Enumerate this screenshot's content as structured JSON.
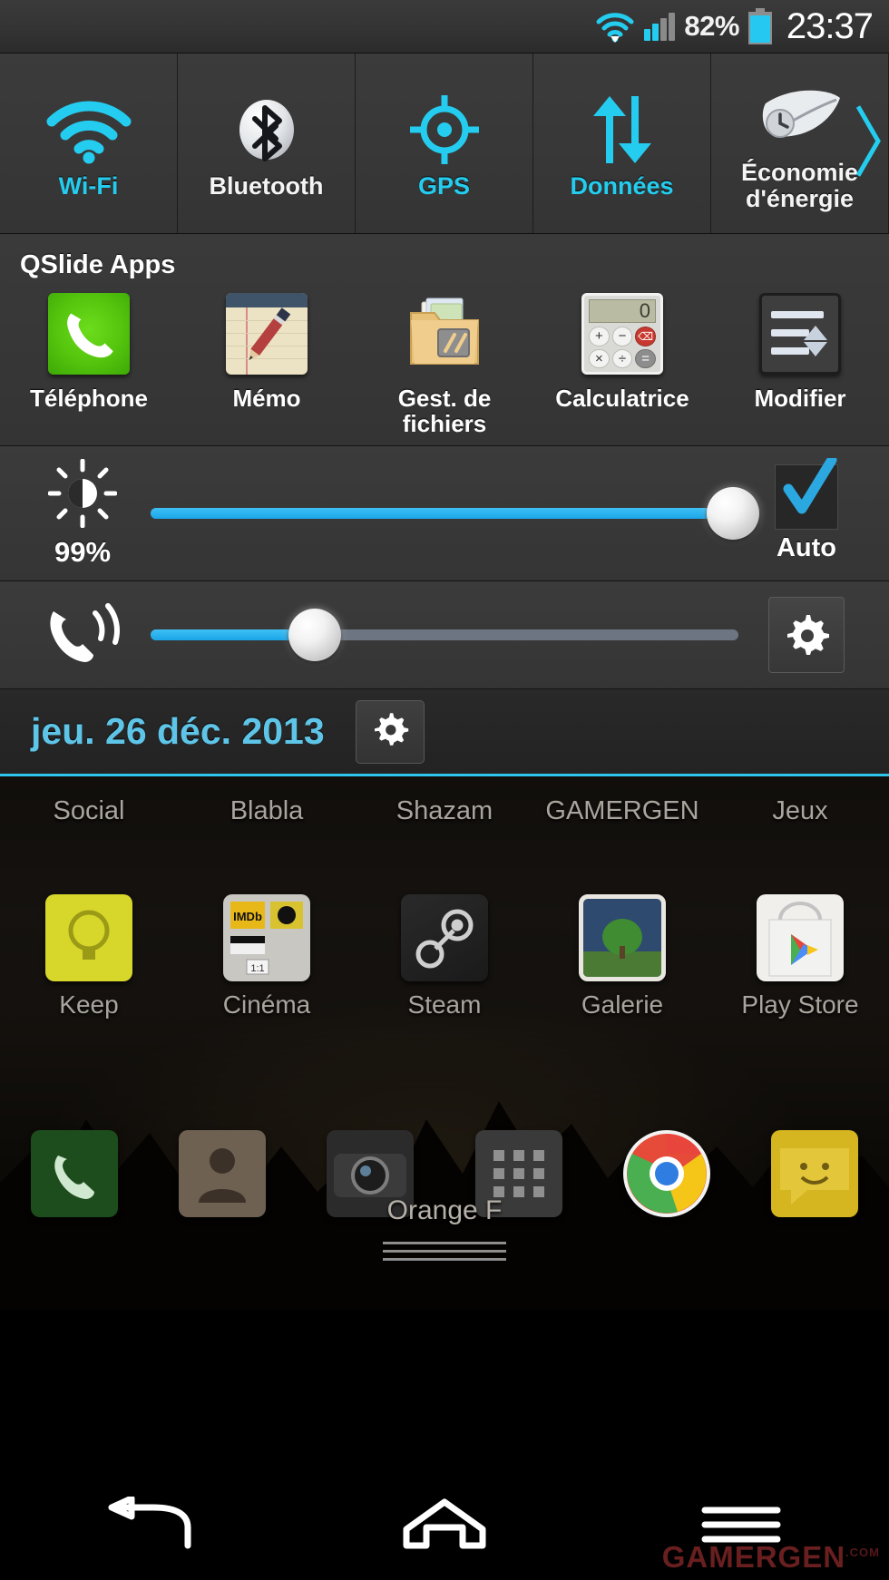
{
  "status_bar": {
    "wifi_icon": "wifi-icon",
    "signal_icon": "cellular-signal-icon",
    "battery_percent": "82%",
    "battery_icon": "battery-icon",
    "clock": "23:37",
    "accent_color": "#24cdef"
  },
  "quick_toggles": [
    {
      "label": "Wi-Fi",
      "icon": "wifi-icon",
      "state": "on"
    },
    {
      "label": "Bluetooth",
      "icon": "bluetooth-icon",
      "state": "off"
    },
    {
      "label": "GPS",
      "icon": "gps-icon",
      "state": "on"
    },
    {
      "label": "Données",
      "icon": "data-sync-icon",
      "state": "on"
    },
    {
      "label": "Économie d'énergie",
      "icon": "power-saver-icon",
      "state": "off"
    }
  ],
  "toggles_scroll_chevron": "chevron-right-icon",
  "qslide": {
    "title": "QSlide Apps",
    "apps": [
      {
        "label": "Téléphone",
        "icon": "phone-icon"
      },
      {
        "label": "Mémo",
        "icon": "memo-notepad-icon"
      },
      {
        "label": "Gest. de fichiers",
        "icon": "file-manager-icon"
      },
      {
        "label": "Calculatrice",
        "icon": "calculator-icon"
      },
      {
        "label": "Modifier",
        "icon": "edit-list-icon"
      }
    ]
  },
  "brightness": {
    "icon": "brightness-sun-icon",
    "value_label": "99%",
    "percent": 99,
    "auto_label": "Auto",
    "auto_checked": true,
    "auto_icon": "checkmark-icon"
  },
  "volume": {
    "icon": "ringer-volume-icon",
    "percent": 28,
    "settings_icon": "gear-icon"
  },
  "date_bar": {
    "date": "jeu. 26 déc. 2013",
    "settings_icon": "gear-icon",
    "date_color": "#5ec5e8",
    "divider_color": "#2ec6ea"
  },
  "homescreen": {
    "folders": [
      "Social",
      "Blabla",
      "Shazam",
      "GAMERGEN",
      "Jeux"
    ],
    "apps": [
      {
        "label": "Keep",
        "icon": "google-keep-icon"
      },
      {
        "label": "Cinéma",
        "icon": "cinema-folder-icon"
      },
      {
        "label": "Steam",
        "icon": "steam-icon"
      },
      {
        "label": "Galerie",
        "icon": "gallery-icon"
      },
      {
        "label": "Play Store",
        "icon": "play-store-icon"
      }
    ],
    "dock": [
      {
        "label": "",
        "icon": "dialer-icon"
      },
      {
        "label": "",
        "icon": "contacts-icon"
      },
      {
        "label": "",
        "icon": "camera-icon"
      },
      {
        "label": "",
        "icon": "app-drawer-icon"
      },
      {
        "label": "",
        "icon": "chrome-icon"
      },
      {
        "label": "",
        "icon": "messaging-icon"
      }
    ],
    "carrier": "Orange F",
    "drag_handle": "shade-drag-handle"
  },
  "nav_bar": {
    "back": "back-icon",
    "home": "home-icon",
    "menu": "menu-icon"
  },
  "watermark": {
    "text": "GAMERGEN",
    "suffix": ".COM"
  }
}
